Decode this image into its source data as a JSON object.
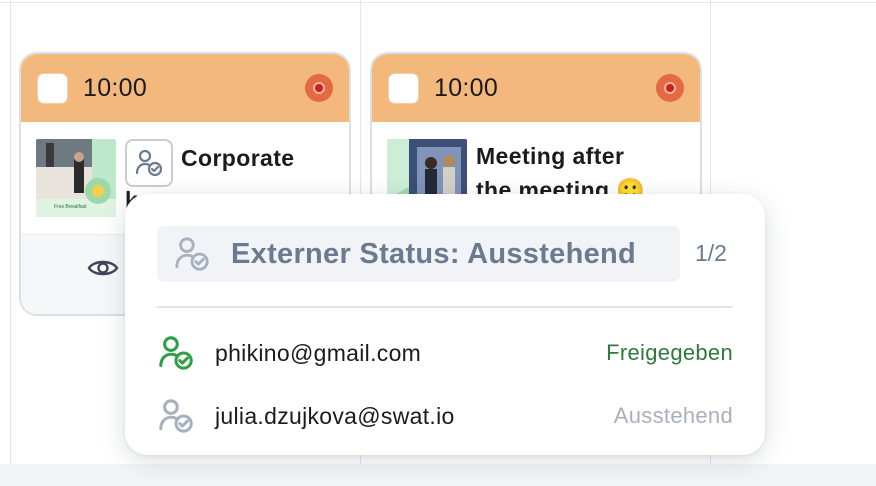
{
  "calendar": {
    "cards": [
      {
        "time": "10:00",
        "title": "Corporate",
        "title_overflow": "k",
        "thumbnail_caption": "Fres Breakfast"
      },
      {
        "time": "10:00",
        "title_line1": "Meeting after",
        "title_line2": "the meeting 🙂"
      }
    ]
  },
  "popover": {
    "title": "Externer Status: Ausstehend",
    "count": "1/2",
    "rows": [
      {
        "email": "phikino@gmail.com",
        "status": "Freigegeben",
        "status_color": "#2f7a3c",
        "icon_color": "#2f9e46"
      },
      {
        "email": "julia.dzujkova@swat.io",
        "status": "Ausstehend",
        "status_color": "#a7b0bd",
        "icon_color": "#a7b0bd"
      }
    ]
  },
  "colors": {
    "card_header": "#f3b97c",
    "muted_text": "#6a7a90",
    "approved": "#2f7a3c",
    "pending": "#a7b0bd"
  },
  "icons": [
    "user-check-icon",
    "eye-icon",
    "avatar-icon",
    "checkbox-icon"
  ]
}
